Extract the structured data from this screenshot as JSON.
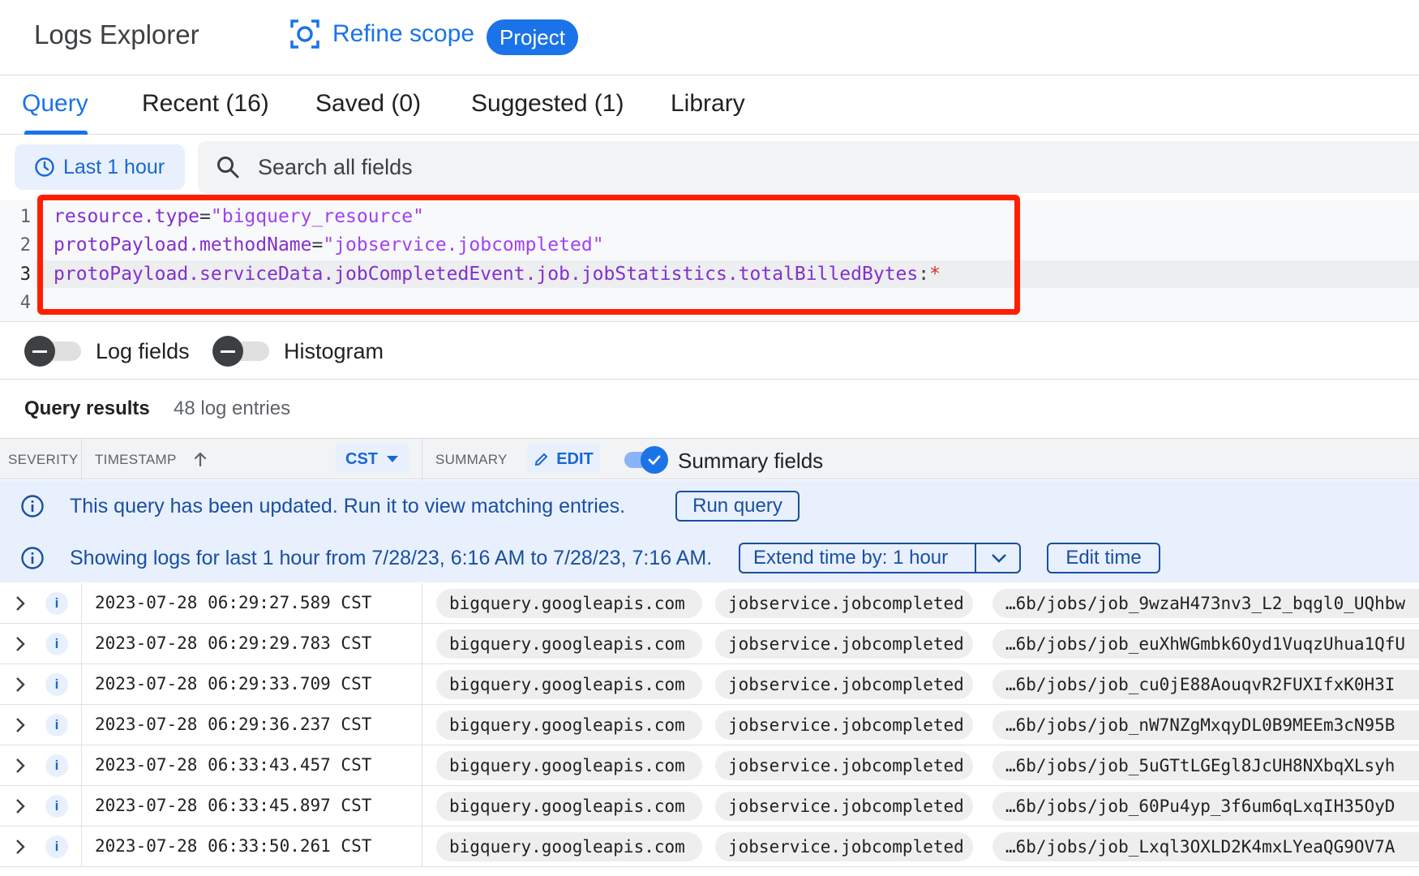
{
  "header": {
    "app_title": "Logs Explorer",
    "refine_label": "Refine scope",
    "project_badge": "Project"
  },
  "tabs": [
    {
      "label": "Query",
      "active": true
    },
    {
      "label": "Recent (16)",
      "active": false
    },
    {
      "label": "Saved (0)",
      "active": false
    },
    {
      "label": "Suggested (1)",
      "active": false
    },
    {
      "label": "Library",
      "active": false
    }
  ],
  "time_range": {
    "label": "Last 1 hour"
  },
  "search": {
    "placeholder": "Search all fields"
  },
  "editor": {
    "line_numbers": [
      "1",
      "2",
      "3",
      "4"
    ],
    "lines": [
      {
        "key": "resource.type",
        "op": "=",
        "value": "\"bigquery_resource\""
      },
      {
        "key": "protoPayload.methodName",
        "op": "=",
        "value": "\"jobservice.jobcompleted\""
      },
      {
        "key": "protoPayload.serviceData.jobCompletedEvent.job.jobStatistics.totalBilledBytes",
        "op": ":",
        "value": "*"
      }
    ]
  },
  "toggles": {
    "log_fields": "Log fields",
    "histogram": "Histogram"
  },
  "results": {
    "title": "Query results",
    "count": "48 log entries"
  },
  "columns": {
    "severity": "SEVERITY",
    "timestamp": "TIMESTAMP",
    "timezone": "CST",
    "summary": "SUMMARY",
    "edit": "EDIT",
    "summary_fields": "Summary fields"
  },
  "banners": {
    "updated_text": "This query has been updated. Run it to view matching entries.",
    "run_query": "Run query",
    "showing_text": "Showing logs for last 1 hour from 7/28/23, 6:16 AM to 7/28/23, 7:16 AM.",
    "extend_time": "Extend time by: 1 hour",
    "edit_time": "Edit time"
  },
  "rows": [
    {
      "severity": "i",
      "timestamp": "2023-07-28 06:29:27.589 CST",
      "service": "bigquery.googleapis.com",
      "method": "jobservice.jobcompleted",
      "resource": "…6b/jobs/job_9wzaH473nv3_L2_bqgl0_UQhbw"
    },
    {
      "severity": "i",
      "timestamp": "2023-07-28 06:29:29.783 CST",
      "service": "bigquery.googleapis.com",
      "method": "jobservice.jobcompleted",
      "resource": "…6b/jobs/job_euXhWGmbk6Oyd1VuqzUhua1QfU"
    },
    {
      "severity": "i",
      "timestamp": "2023-07-28 06:29:33.709 CST",
      "service": "bigquery.googleapis.com",
      "method": "jobservice.jobcompleted",
      "resource": "…6b/jobs/job_cu0jE88AouqvR2FUXIfxK0H3I"
    },
    {
      "severity": "i",
      "timestamp": "2023-07-28 06:29:36.237 CST",
      "service": "bigquery.googleapis.com",
      "method": "jobservice.jobcompleted",
      "resource": "…6b/jobs/job_nW7NZgMxqyDL0B9MEEm3cN95B"
    },
    {
      "severity": "i",
      "timestamp": "2023-07-28 06:33:43.457 CST",
      "service": "bigquery.googleapis.com",
      "method": "jobservice.jobcompleted",
      "resource": "…6b/jobs/job_5uGTtLGEgl8JcUH8NXbqXLsyh"
    },
    {
      "severity": "i",
      "timestamp": "2023-07-28 06:33:45.897 CST",
      "service": "bigquery.googleapis.com",
      "method": "jobservice.jobcompleted",
      "resource": "…6b/jobs/job_60Pu4yp_3f6um6qLxqIH35OyD"
    },
    {
      "severity": "i",
      "timestamp": "2023-07-28 06:33:50.261 CST",
      "service": "bigquery.googleapis.com",
      "method": "jobservice.jobcompleted",
      "resource": "…6b/jobs/job_Lxql3OXLD2K4mxLYeaQG9OV7A"
    }
  ],
  "icons": {
    "refine": "focus-frame-icon",
    "time": "clock-icon",
    "search": "search-icon",
    "sort": "arrow-up-icon",
    "dropdown": "caret-down-icon",
    "edit": "pencil-icon",
    "info": "info-icon",
    "expand": "chevron-right-icon"
  },
  "colors": {
    "accent": "#1a73e8",
    "highlight": "#ff1f00",
    "banner_bg": "#e8f0fe"
  }
}
